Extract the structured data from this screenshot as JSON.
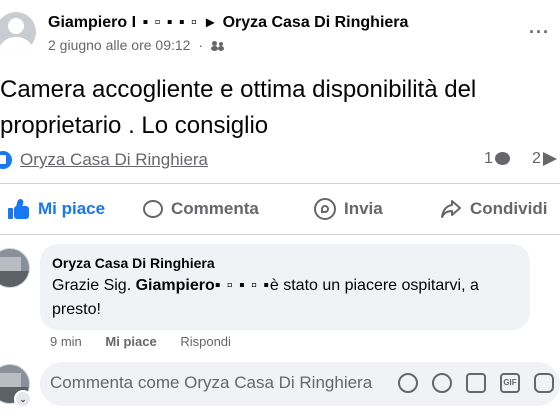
{
  "post": {
    "author": "Giampiero",
    "author_redacted": "I ▪ ▫ ▪ ▪ ▫",
    "arrow": "▸",
    "page": "Oryza Casa Di Ringhiera",
    "date": "2 giugno alle ore 09:12",
    "dot": "·",
    "audience_icon": "friends-icon",
    "more": "···",
    "text": "Camera accogliente e ottima disponibilità del proprietario . Lo consiglio"
  },
  "stats": {
    "reaction_icon": "like-icon",
    "reactions_by": "Oryza Casa Di Ringhiera",
    "comments_count": "1",
    "shares_count": "2"
  },
  "actions": {
    "like": "Mi piace",
    "comment": "Commenta",
    "send": "Invia",
    "share": "Condividi"
  },
  "comment": {
    "author": "Oryza Casa Di Ringhiera",
    "text_before": "Grazie Sig. ",
    "text_name": "Giampiero",
    "text_redacted": " ▪ ▫ ▪ ▫ ▪ ",
    "text_after": "è stato un piacere ospitarvi, a presto!",
    "time": "9 min",
    "like": "Mi piace",
    "reply": "Rispondi"
  },
  "compose": {
    "placeholder": "Commenta come Oryza Casa Di Ringhiera",
    "caret": "⌄",
    "icons": [
      "avatar-sticker-icon",
      "emoji-icon",
      "camera-icon",
      "gif-icon",
      "sticker-icon"
    ]
  },
  "colors": {
    "accent": "#1877f2",
    "secondary_text": "#65676b",
    "bubble_bg": "#f0f2f5",
    "divider": "#ced0d4"
  }
}
